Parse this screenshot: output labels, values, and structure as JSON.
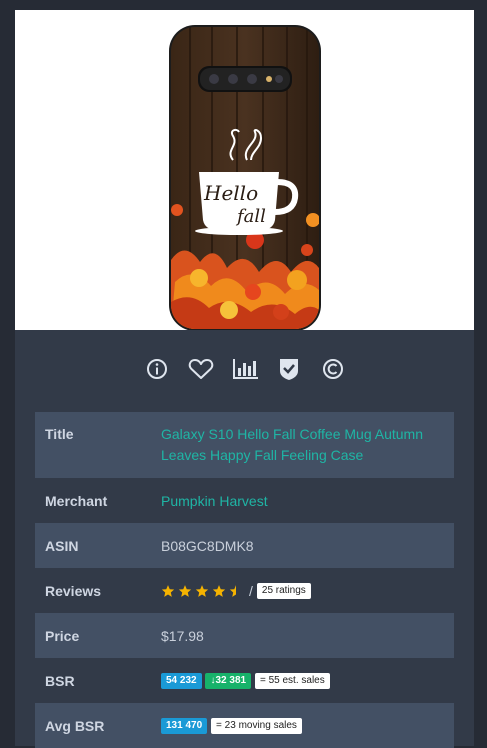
{
  "product": {
    "image_alt": "Galaxy S10 phone case with Hello fall coffee mug and autumn leaves",
    "mug_text_line1": "Hello",
    "mug_text_line2": "fall"
  },
  "actions": [
    {
      "name": "info-icon"
    },
    {
      "name": "heart-icon"
    },
    {
      "name": "chart-icon"
    },
    {
      "name": "shield-check-icon"
    },
    {
      "name": "copyright-icon"
    }
  ],
  "details": {
    "title_label": "Title",
    "title_value": "Galaxy S10 Hello Fall Coffee Mug Autumn Leaves Happy Fall Feeling Case",
    "merchant_label": "Merchant",
    "merchant_value": "Pumpkin Harvest",
    "asin_label": "ASIN",
    "asin_value": "B08GC8DMK8",
    "reviews_label": "Reviews",
    "reviews_rating": 4.5,
    "reviews_separator": "/",
    "reviews_count": "25 ratings",
    "price_label": "Price",
    "price_value": "$17.98",
    "bsr_label": "BSR",
    "bsr_value": "54 232",
    "bsr_change": "32 381",
    "bsr_sales": "= 55 est. sales",
    "avg_bsr_label": "Avg BSR",
    "avg_bsr_value": "131 470",
    "avg_bsr_sales": "= 23 moving sales"
  },
  "colors": {
    "page_bg": "#262b35",
    "card_bg": "#323a48",
    "row_alt_bg": "#435064",
    "link": "#1fb5a5",
    "star": "#f5b301",
    "chip_blue": "#1a9ad6",
    "chip_green": "#17b26a"
  }
}
